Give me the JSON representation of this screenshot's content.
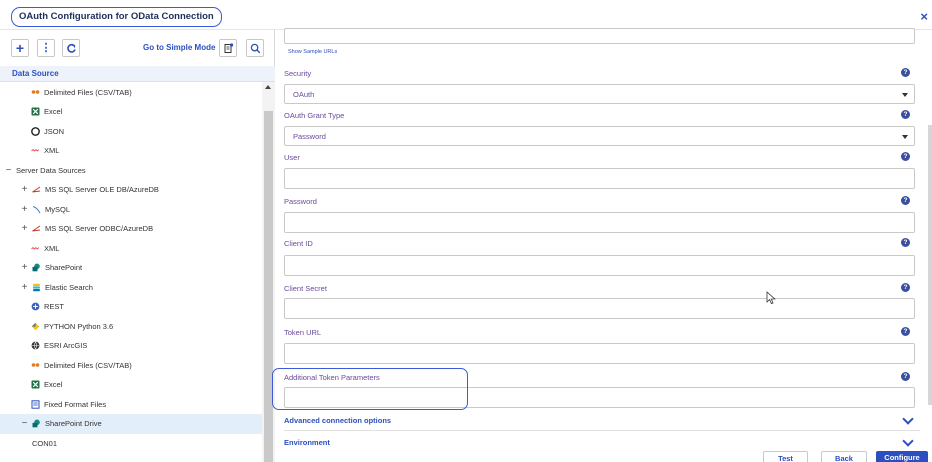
{
  "window": {
    "title": "OAuth Configuration for OData Connection",
    "close_glyph": "×"
  },
  "toolbar": {
    "add_glyph": "+",
    "more_glyph": "⋮",
    "simple_mode_label": "Go to Simple Mode"
  },
  "left_panel": {
    "header": "Data Source",
    "tree": [
      {
        "label": "Delimited Files (CSV/TAB)",
        "icon": "quote-icon",
        "expander": ""
      },
      {
        "label": "Excel",
        "icon": "excel-icon",
        "expander": ""
      },
      {
        "label": "JSON",
        "icon": "json-icon",
        "expander": ""
      },
      {
        "label": "XML",
        "icon": "xml-icon",
        "expander": ""
      },
      {
        "label": "Server Data Sources",
        "icon": "",
        "expander": "−"
      },
      {
        "label": "MS SQL Server OLE DB/AzureDB",
        "icon": "sqlserver-icon",
        "expander": "+"
      },
      {
        "label": "MySQL",
        "icon": "mysql-icon",
        "expander": "+"
      },
      {
        "label": "MS SQL Server ODBC/AzureDB",
        "icon": "sqlserver-icon",
        "expander": "+"
      },
      {
        "label": "XML",
        "icon": "xml-icon",
        "expander": ""
      },
      {
        "label": "SharePoint",
        "icon": "sharepoint-icon",
        "expander": "+"
      },
      {
        "label": "Elastic Search",
        "icon": "elastic-icon",
        "expander": "+"
      },
      {
        "label": "REST",
        "icon": "rest-icon",
        "expander": ""
      },
      {
        "label": "PYTHON Python 3.6",
        "icon": "python-icon",
        "expander": ""
      },
      {
        "label": "ESRI ArcGIS",
        "icon": "globe-icon",
        "expander": ""
      },
      {
        "label": "Delimited Files (CSV/TAB)",
        "icon": "quote-icon",
        "expander": ""
      },
      {
        "label": "Excel",
        "icon": "excel-icon",
        "expander": ""
      },
      {
        "label": "Fixed Format Files",
        "icon": "fixed-file-icon",
        "expander": ""
      },
      {
        "label": "SharePoint Drive",
        "icon": "sharepoint-icon",
        "expander": "−"
      },
      {
        "label": "CON01",
        "icon": "",
        "expander": ""
      }
    ],
    "selected_index": 17
  },
  "form": {
    "show_sample_urls": "Show Sample URLs",
    "help_glyph": "?",
    "security": {
      "label": "Security",
      "value": "OAuth"
    },
    "grant_type": {
      "label": "OAuth Grant Type",
      "value": "Password"
    },
    "user": {
      "label": "User",
      "value": ""
    },
    "password": {
      "label": "Password",
      "value": ""
    },
    "client_id": {
      "label": "Client ID",
      "value": ""
    },
    "client_secret": {
      "label": "Client Secret",
      "value": ""
    },
    "token_url": {
      "label": "Token URL",
      "value": ""
    },
    "additional_params": {
      "label": "Additional Token Parameters",
      "value": ""
    }
  },
  "sections": {
    "advanced": "Advanced connection options",
    "environment": "Environment"
  },
  "buttons": {
    "test": "Test",
    "back": "Back",
    "configure": "Configure"
  },
  "colors": {
    "accent": "#2c4fbf",
    "highlight_outline": "#3d5bd9",
    "label_purple": "#6a4a9c",
    "selected_row": "#e3eefb"
  }
}
